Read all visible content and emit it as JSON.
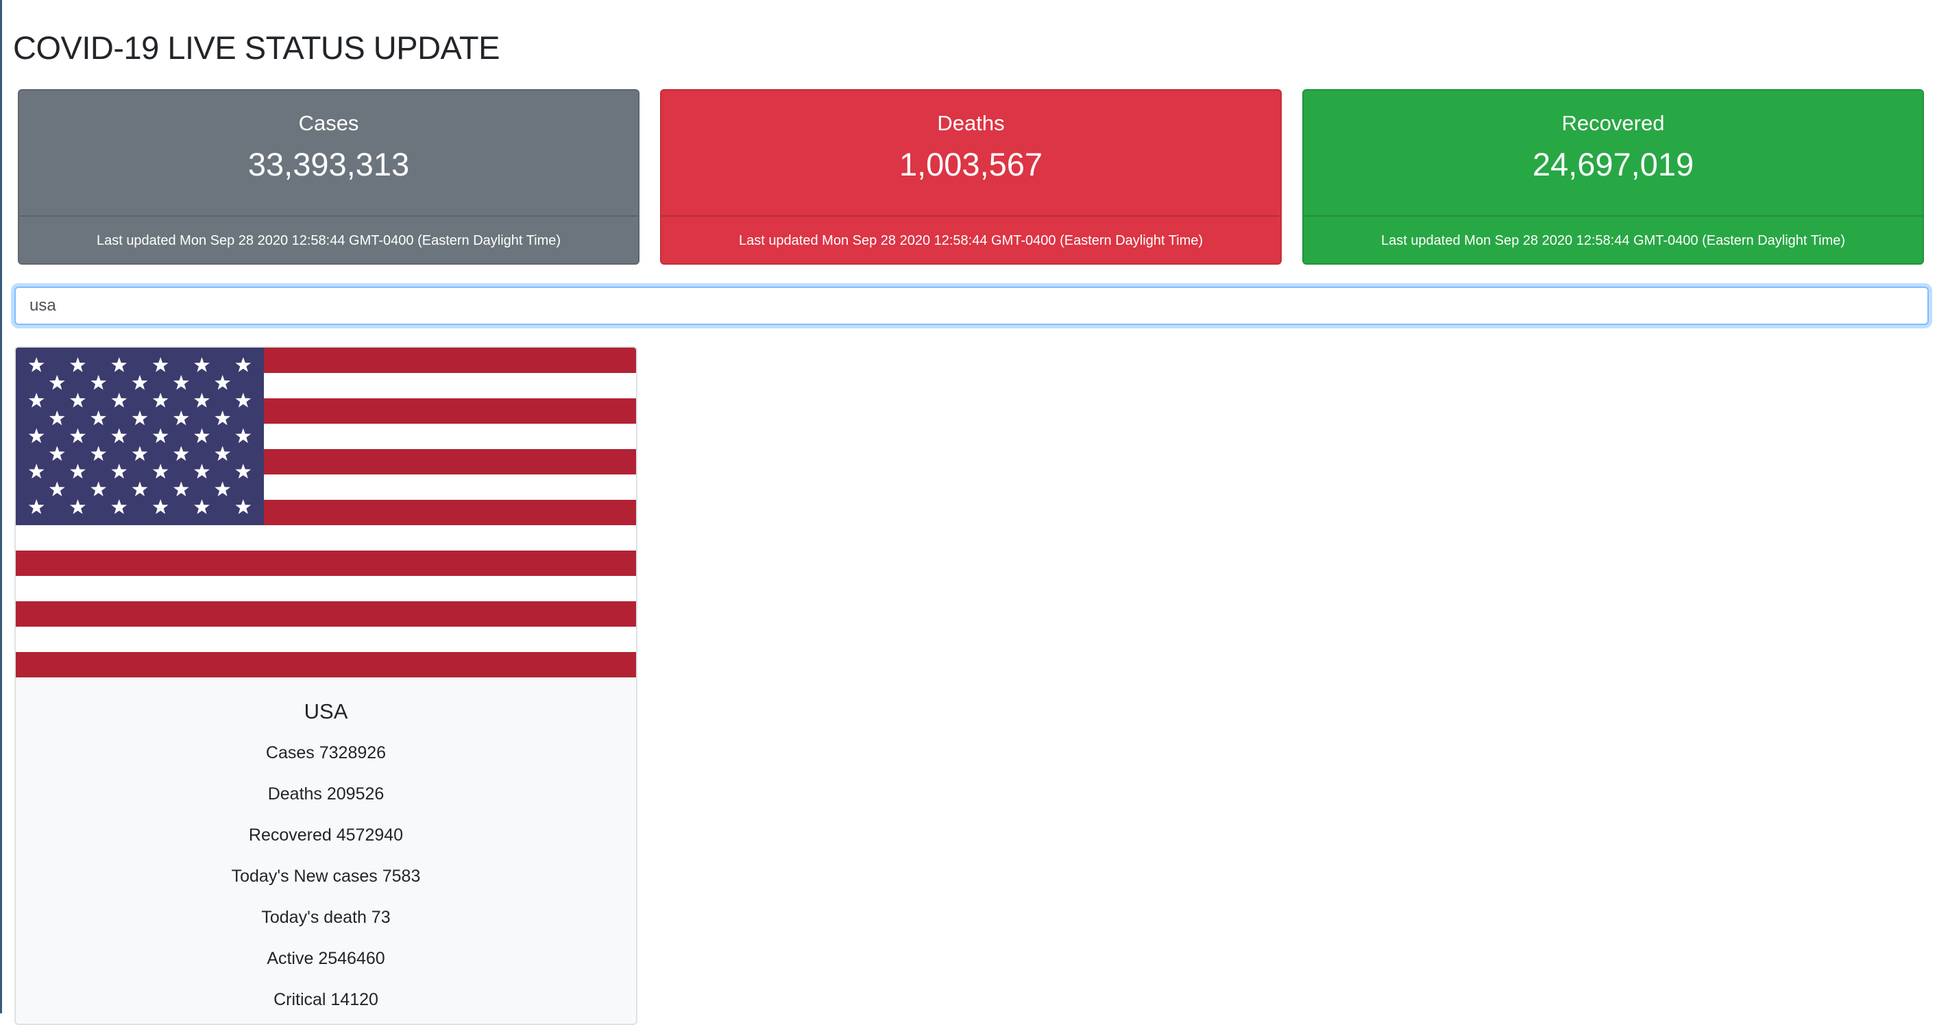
{
  "header": {
    "title": "COVID-19 LIVE STATUS UPDATE"
  },
  "summary_cards": [
    {
      "label": "Cases",
      "value": "33,393,313",
      "updated": "Last updated Mon Sep 28 2020 12:58:44 GMT-0400 (Eastern Daylight Time)",
      "color": "#6c757d"
    },
    {
      "label": "Deaths",
      "value": "1,003,567",
      "updated": "Last updated Mon Sep 28 2020 12:58:44 GMT-0400 (Eastern Daylight Time)",
      "color": "#dc3545"
    },
    {
      "label": "Recovered",
      "value": "24,697,019",
      "updated": "Last updated Mon Sep 28 2020 12:58:44 GMT-0400 (Eastern Daylight Time)",
      "color": "#28a745"
    }
  ],
  "search": {
    "value": "usa"
  },
  "country": {
    "flag_icon": "usa-flag",
    "name": "USA",
    "stats": [
      "Cases 7328926",
      "Deaths 209526",
      "Recovered 4572940",
      "Today's New cases 7583",
      "Today's death 73",
      "Active 2546460",
      "Critical 14120"
    ]
  }
}
